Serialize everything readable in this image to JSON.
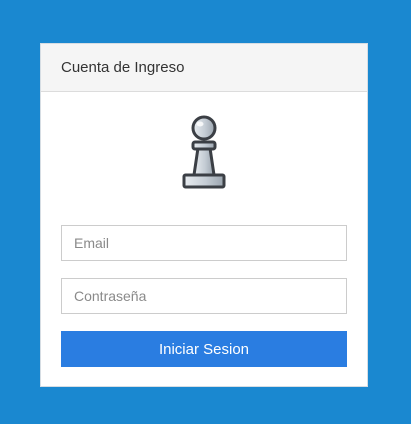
{
  "login": {
    "title": "Cuenta de Ingreso",
    "logo_icon": "chess-pawn-icon",
    "email_placeholder": "Email",
    "email_value": "",
    "password_placeholder": "Contraseña",
    "password_value": "",
    "submit_label": "Iniciar Sesion"
  },
  "colors": {
    "background": "#1a88d0",
    "button": "#2a7de1",
    "header": "#f5f5f5"
  }
}
